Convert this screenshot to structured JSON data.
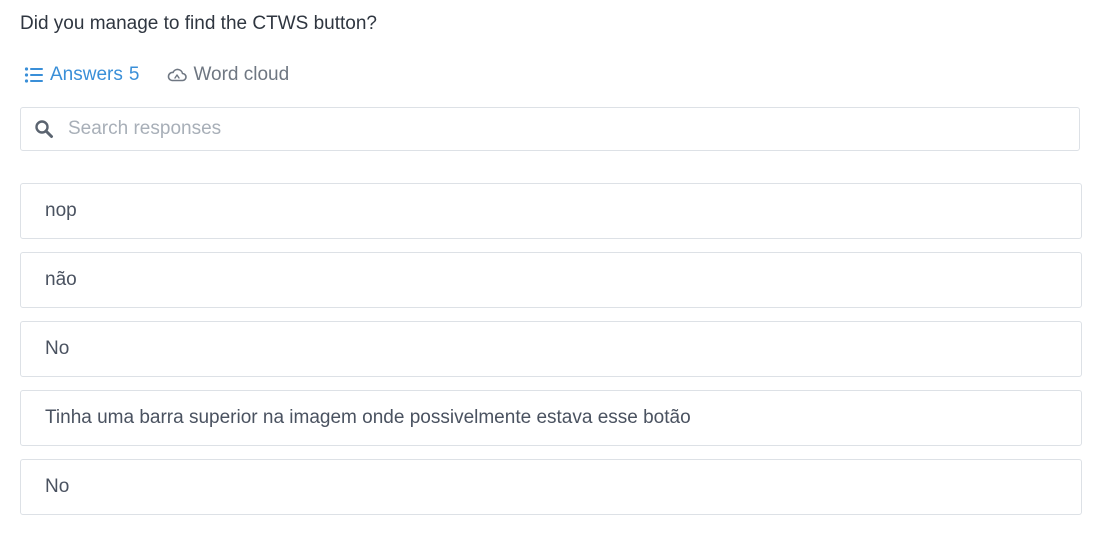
{
  "question": "Did you manage to find the CTWS button?",
  "tabs": {
    "answers_label": "Answers",
    "answers_count": "5",
    "wordcloud_label": "Word cloud"
  },
  "search": {
    "placeholder": "Search responses",
    "value": ""
  },
  "responses": [
    "nop",
    "não",
    "No",
    "Tinha uma barra superior na imagem onde possivelmente estava esse botão",
    "No"
  ],
  "colors": {
    "accent": "#3a8fd8",
    "border": "#dde1e6",
    "muted": "#6f7782"
  },
  "icons": {
    "answers": "list-icon",
    "wordcloud": "cloud-icon",
    "search": "search-icon"
  }
}
